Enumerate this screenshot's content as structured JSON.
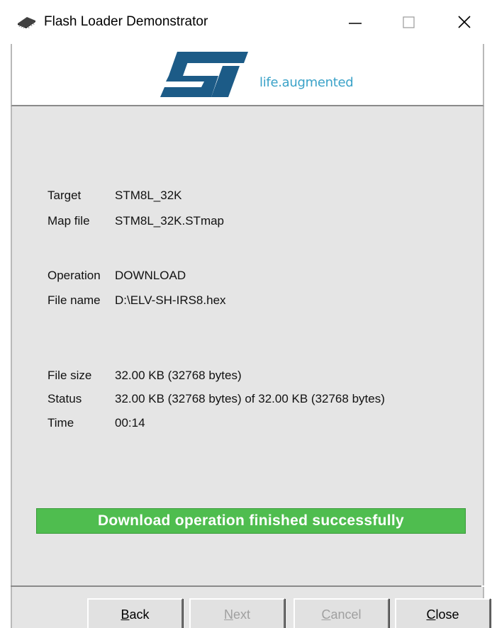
{
  "window": {
    "title": "Flash Loader Demonstrator",
    "icon": "chip-icon"
  },
  "banner": {
    "logo": "ST",
    "tagline": "life.augmented",
    "colors": {
      "logo_blue": "#1c5b87",
      "tagline": "#3aa2c8"
    }
  },
  "info": {
    "target_label": "Target",
    "target_value": "STM8L_32K",
    "mapfile_label": "Map file",
    "mapfile_value": "STM8L_32K.STmap",
    "operation_label": "Operation",
    "operation_value": "DOWNLOAD",
    "filename_label": "File name",
    "filename_value": "D:\\ELV-SH-IRS8.hex",
    "filesize_label": "File size",
    "filesize_value": "32.00 KB (32768 bytes)",
    "status_label": "Status",
    "status_value": "32.00 KB (32768 bytes) of 32.00 KB (32768 bytes)",
    "time_label": "Time",
    "time_value": "00:14"
  },
  "progress": {
    "message": "Download operation finished successfully",
    "percent": 100,
    "color": "#4fbd4f"
  },
  "buttons": {
    "back_mnemonic": "B",
    "back_rest": "ack",
    "next_mnemonic": "N",
    "next_rest": "ext",
    "cancel_mnemonic": "C",
    "cancel_rest": "ancel",
    "close_mnemonic": "C",
    "close_rest": "lose"
  }
}
